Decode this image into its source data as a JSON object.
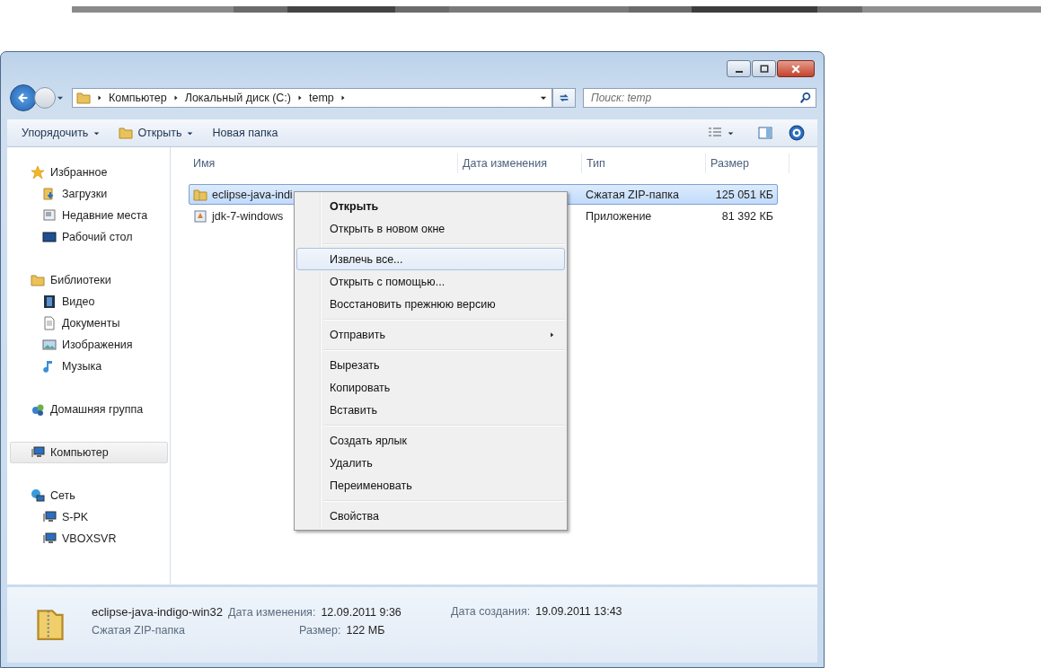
{
  "address": {
    "crumbs": [
      "Компьютер",
      "Локальный диск (C:)",
      "temp"
    ],
    "search": {
      "placeholder": "Поиск: temp"
    }
  },
  "toolbar": [
    {
      "label": "Упорядочить",
      "dropdown": true
    },
    {
      "label": "Открыть",
      "dropdown": true
    },
    {
      "label": "Новая папка",
      "dropdown": false
    }
  ],
  "sidebar": {
    "groups": [
      {
        "label": "Избранное",
        "selected": false,
        "items": [
          {
            "label": "Загрузки"
          },
          {
            "label": "Недавние места"
          },
          {
            "label": "Рабочий стол"
          }
        ]
      },
      {
        "label": "Библиотеки",
        "selected": false,
        "items": [
          {
            "label": "Видео"
          },
          {
            "label": "Документы"
          },
          {
            "label": "Изображения"
          },
          {
            "label": "Музыка"
          }
        ]
      },
      {
        "label": "Домашняя группа",
        "selected": false
      },
      {
        "label": "Компьютер",
        "selected": true
      },
      {
        "label": "Сеть",
        "selected": false,
        "items": [
          {
            "label": "S-PK"
          },
          {
            "label": "VBOXSVR"
          }
        ]
      }
    ]
  },
  "table": {
    "columns": [
      "Имя",
      "Дата изменения",
      "Тип",
      "Размер"
    ],
    "rows": [
      {
        "name": "eclipse-java-indi",
        "type": "Сжатая ZIP-папка",
        "size": "125 051 КБ",
        "selected": true
      },
      {
        "name": "jdk-7-windows",
        "type": "Приложение",
        "size": "81 392 КБ",
        "selected": false
      }
    ]
  },
  "context_menu": [
    {
      "kind": "item",
      "label": "Открыть",
      "default": true,
      "selected": false,
      "submenu": false
    },
    {
      "kind": "item",
      "label": "Открыть в новом окне",
      "default": false,
      "selected": false,
      "submenu": false
    },
    {
      "kind": "separator"
    },
    {
      "kind": "item",
      "label": "Извлечь все...",
      "default": false,
      "selected": true,
      "submenu": false
    },
    {
      "kind": "item",
      "label": "Открыть с помощью...",
      "default": false,
      "selected": false,
      "submenu": false
    },
    {
      "kind": "item",
      "label": "Восстановить прежнюю версию",
      "default": false,
      "selected": false,
      "submenu": false
    },
    {
      "kind": "separator"
    },
    {
      "kind": "item",
      "label": "Отправить",
      "default": false,
      "selected": false,
      "submenu": true
    },
    {
      "kind": "separator"
    },
    {
      "kind": "item",
      "label": "Вырезать",
      "default": false,
      "selected": false,
      "submenu": false
    },
    {
      "kind": "item",
      "label": "Копировать",
      "default": false,
      "selected": false,
      "submenu": false
    },
    {
      "kind": "item",
      "label": "Вставить",
      "default": false,
      "selected": false,
      "submenu": false
    },
    {
      "kind": "separator"
    },
    {
      "kind": "item",
      "label": "Создать ярлык",
      "default": false,
      "selected": false,
      "submenu": false
    },
    {
      "kind": "item",
      "label": "Удалить",
      "default": false,
      "selected": false,
      "submenu": false
    },
    {
      "kind": "item",
      "label": "Переименовать",
      "default": false,
      "selected": false,
      "submenu": false
    },
    {
      "kind": "separator"
    },
    {
      "kind": "item",
      "label": "Свойства",
      "default": false,
      "selected": false,
      "submenu": false
    }
  ],
  "details": {
    "name": "eclipse-java-indigo-win32",
    "type": "Сжатая ZIP-папка",
    "fields": [
      {
        "label": "Дата изменения:",
        "value": "12.09.2011 9:36"
      },
      {
        "label": "Размер:",
        "value": "122 МБ"
      },
      {
        "label": "Дата создания:",
        "value": "19.09.2011 13:43"
      }
    ]
  }
}
